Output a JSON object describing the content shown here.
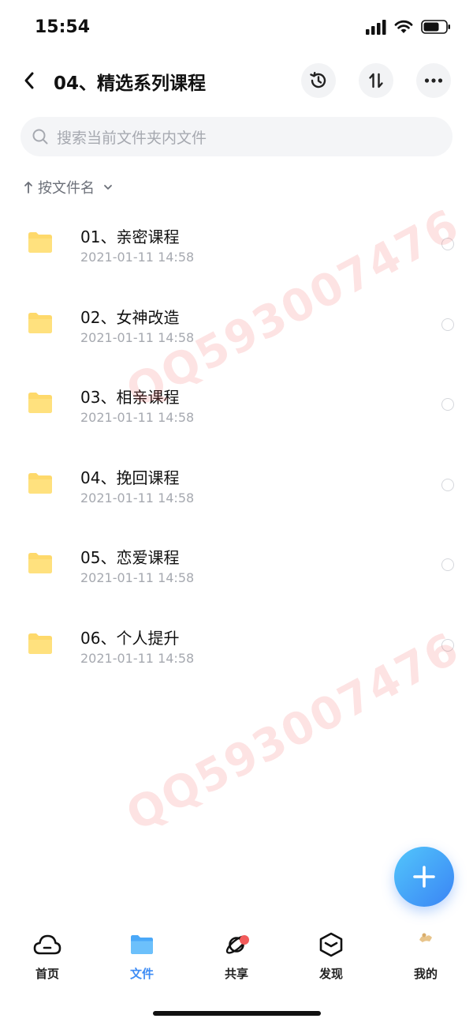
{
  "status_bar": {
    "time": "15:54"
  },
  "nav": {
    "title": "04、精选系列课程"
  },
  "search": {
    "placeholder": "搜索当前文件夹内文件"
  },
  "sort": {
    "label": "按文件名"
  },
  "files": [
    {
      "name": "01、亲密课程",
      "date": "2021-01-11 14:58"
    },
    {
      "name": "02、女神改造",
      "date": "2021-01-11 14:58"
    },
    {
      "name": "03、相亲课程",
      "date": "2021-01-11 14:58"
    },
    {
      "name": "04、挽回课程",
      "date": "2021-01-11 14:58"
    },
    {
      "name": "05、恋爱课程",
      "date": "2021-01-11 14:58"
    },
    {
      "name": "06、个人提升",
      "date": "2021-01-11 14:58"
    }
  ],
  "watermark": {
    "text": "QQ593007476"
  },
  "tabs": [
    {
      "label": "首页",
      "icon": "cloud-icon",
      "active": false
    },
    {
      "label": "文件",
      "icon": "folder-icon",
      "active": true
    },
    {
      "label": "共享",
      "icon": "orbit-icon",
      "active": false,
      "badge": true
    },
    {
      "label": "发现",
      "icon": "cube-icon",
      "active": false
    },
    {
      "label": "我的",
      "icon": "avatar-icon",
      "active": false
    }
  ],
  "colors": {
    "accent": "#3d8cf5",
    "folder": "#fed96b",
    "badge": "#f25b5b"
  }
}
